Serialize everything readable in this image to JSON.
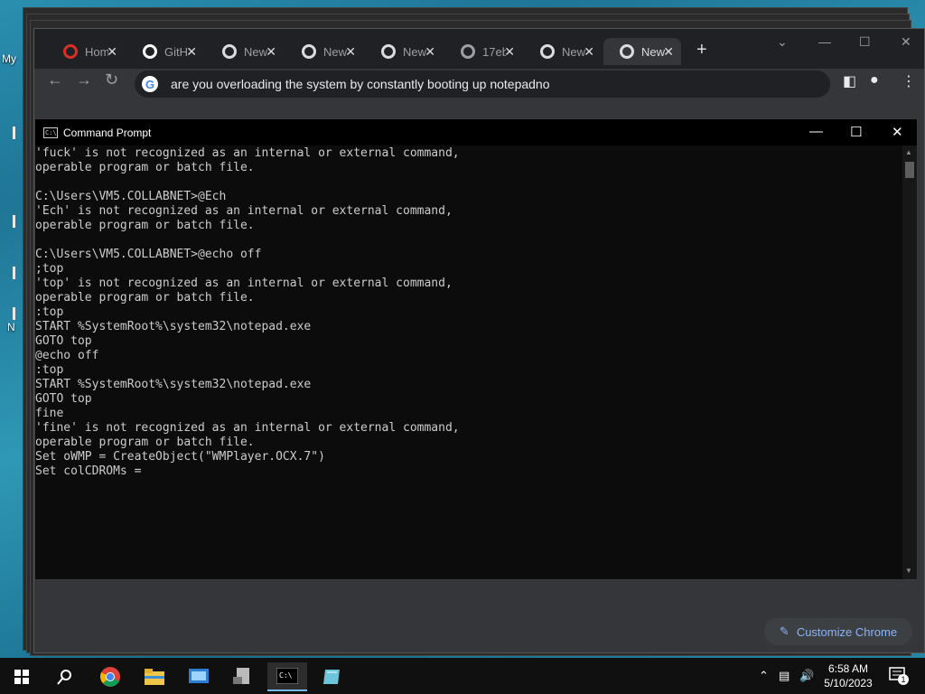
{
  "desktop": {
    "icon_label_1": "My",
    "icon_label_2": "N"
  },
  "chrome": {
    "tabs": [
      {
        "label": "Hom",
        "icon": "home-icon",
        "color": "#d93025"
      },
      {
        "label": "GitH",
        "icon": "github-icon",
        "color": "#ffffff"
      },
      {
        "label": "New",
        "icon": "chrome-icon",
        "color": "#dadce0"
      },
      {
        "label": "New",
        "icon": "chrome-icon",
        "color": "#dadce0"
      },
      {
        "label": "New",
        "icon": "chrome-icon",
        "color": "#dadce0"
      },
      {
        "label": "17eb",
        "icon": "globe-icon",
        "color": "#9aa0a6"
      },
      {
        "label": "New",
        "icon": "chrome-icon",
        "color": "#dadce0"
      },
      {
        "label": "New",
        "icon": "chrome-icon",
        "color": "#dadce0",
        "active": true
      }
    ],
    "omnibox_text": "are you overloading the system by constantly booting up notepadno",
    "customize_label": "Customize Chrome"
  },
  "cmd": {
    "title": "Command Prompt",
    "lines": [
      "'fuck' is not recognized as an internal or external command,",
      "operable program or batch file.",
      "",
      "C:\\Users\\VM5.COLLABNET>@Ech",
      "'Ech' is not recognized as an internal or external command,",
      "operable program or batch file.",
      "",
      "C:\\Users\\VM5.COLLABNET>@echo off",
      ";top",
      "'top' is not recognized as an internal or external command,",
      "operable program or batch file.",
      ":top",
      "START %SystemRoot%\\system32\\notepad.exe",
      "GOTO top",
      "@echo off",
      ":top",
      "START %SystemRoot%\\system32\\notepad.exe",
      "GOTO top",
      "fine",
      "'fine' is not recognized as an internal or external command,",
      "operable program or batch file.",
      "Set oWMP = CreateObject(\"WMPlayer.OCX.7\")",
      "Set colCDROMs ="
    ]
  },
  "taskbar": {
    "time": "6:58 AM",
    "date": "5/10/2023",
    "notification_count": "1"
  }
}
